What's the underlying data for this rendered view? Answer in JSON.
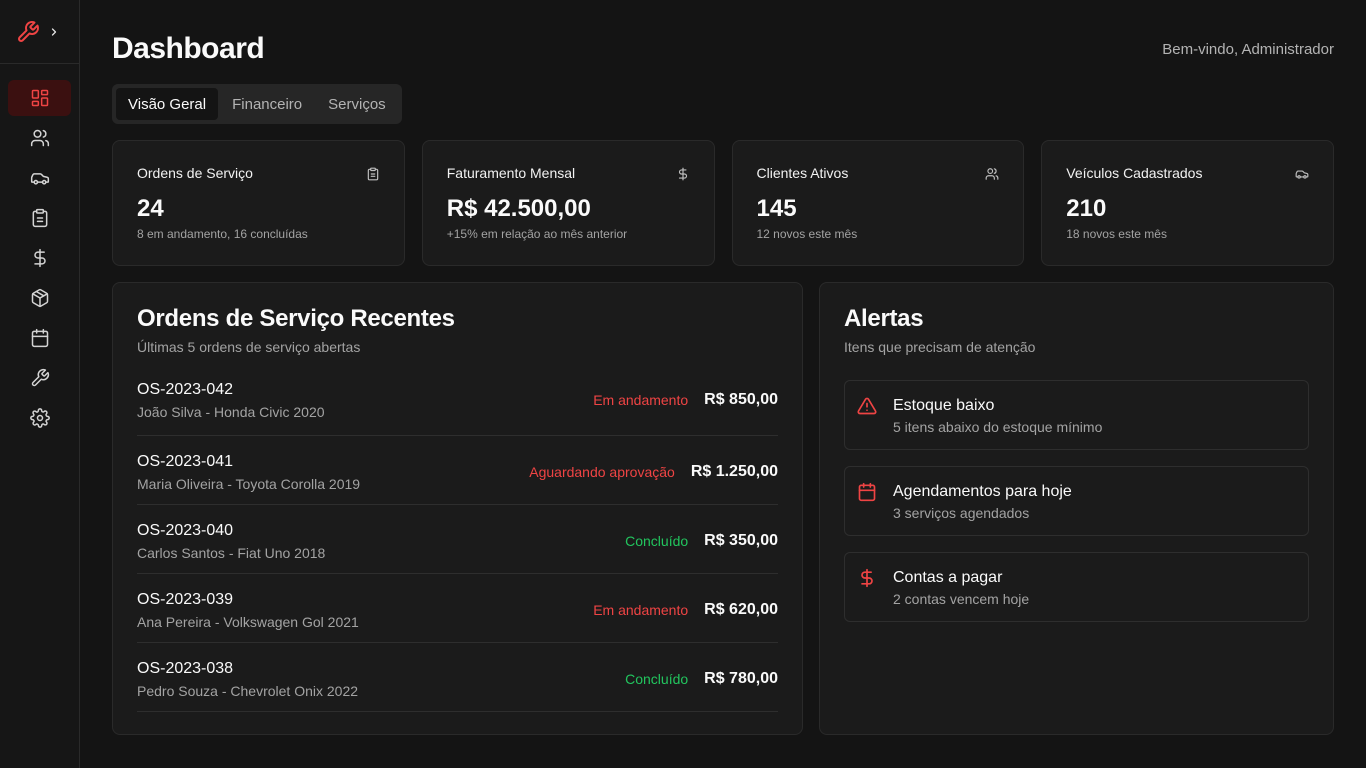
{
  "header": {
    "title": "Dashboard",
    "welcome": "Bem-vindo, Administrador"
  },
  "sidebar": {
    "logo_icon": "wrench-icon",
    "items": [
      {
        "icon": "dashboard-icon",
        "active": true
      },
      {
        "icon": "users-icon"
      },
      {
        "icon": "car-icon"
      },
      {
        "icon": "clipboard-icon"
      },
      {
        "icon": "dollar-icon"
      },
      {
        "icon": "package-icon"
      },
      {
        "icon": "calendar-icon"
      },
      {
        "icon": "wrench-icon"
      },
      {
        "icon": "settings-icon"
      }
    ]
  },
  "tabs": [
    {
      "label": "Visão Geral",
      "active": true
    },
    {
      "label": "Financeiro"
    },
    {
      "label": "Serviços"
    }
  ],
  "stats": [
    {
      "label": "Ordens de Serviço",
      "value": "24",
      "sub": "8 em andamento, 16 concluídas",
      "icon": "clipboard-icon"
    },
    {
      "label": "Faturamento Mensal",
      "value": "R$ 42.500,00",
      "sub": "+15% em relação ao mês anterior",
      "icon": "dollar-icon"
    },
    {
      "label": "Clientes Ativos",
      "value": "145",
      "sub": "12 novos este mês",
      "icon": "users-icon"
    },
    {
      "label": "Veículos Cadastrados",
      "value": "210",
      "sub": "18 novos este mês",
      "icon": "car-icon"
    }
  ],
  "orders_panel": {
    "title": "Ordens de Serviço Recentes",
    "subtitle": "Últimas 5 ordens de serviço abertas",
    "orders": [
      {
        "id": "OS-2023-042",
        "desc": "João Silva - Honda Civic 2020",
        "status": "Em andamento",
        "status_color": "#ef4444",
        "price": "R$ 850,00"
      },
      {
        "id": "OS-2023-041",
        "desc": "Maria Oliveira - Toyota Corolla 2019",
        "status": "Aguardando aprovação",
        "status_color": "#ef4444",
        "price": "R$ 1.250,00"
      },
      {
        "id": "OS-2023-040",
        "desc": "Carlos Santos - Fiat Uno 2018",
        "status": "Concluído",
        "status_color": "#22c55e",
        "price": "R$ 350,00"
      },
      {
        "id": "OS-2023-039",
        "desc": "Ana Pereira - Volkswagen Gol 2021",
        "status": "Em andamento",
        "status_color": "#ef4444",
        "price": "R$ 620,00"
      },
      {
        "id": "OS-2023-038",
        "desc": "Pedro Souza - Chevrolet Onix 2022",
        "status": "Concluído",
        "status_color": "#22c55e",
        "price": "R$ 780,00"
      }
    ]
  },
  "alerts_panel": {
    "title": "Alertas",
    "subtitle": "Itens que precisam de atenção",
    "alerts": [
      {
        "title": "Estoque baixo",
        "desc": "5 itens abaixo do estoque mínimo",
        "icon": "warning-icon"
      },
      {
        "title": "Agendamentos para hoje",
        "desc": "3 serviços agendados",
        "icon": "calendar-icon"
      },
      {
        "title": "Contas a pagar",
        "desc": "2 contas vencem hoje",
        "icon": "dollar-icon"
      }
    ]
  },
  "colors": {
    "accent": "#ef4444",
    "success": "#22c55e",
    "background": "#141414",
    "card": "#1b1b1b"
  }
}
